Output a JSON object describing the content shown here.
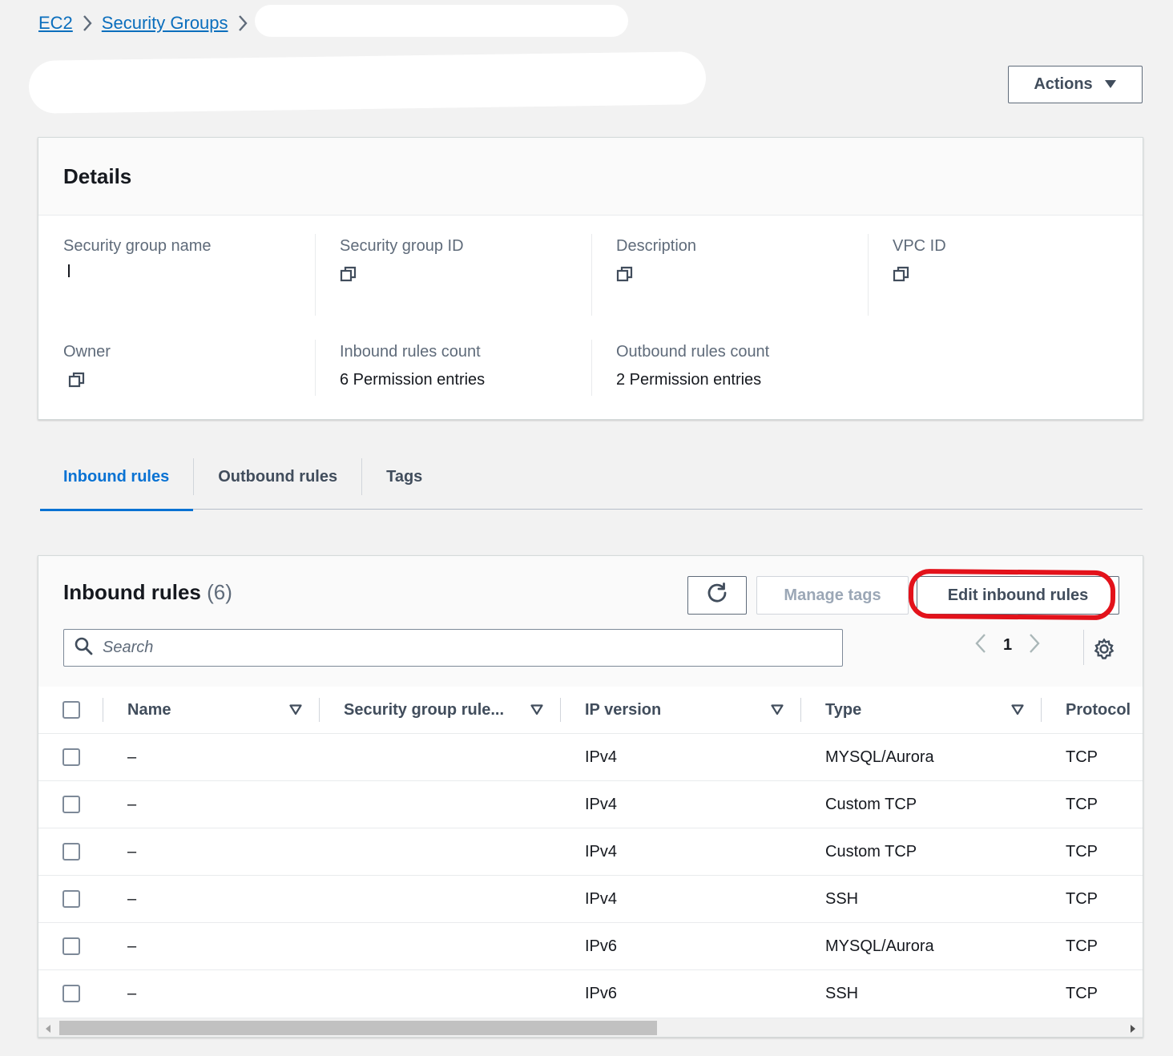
{
  "breadcrumb": {
    "items": [
      "EC2",
      "Security Groups"
    ]
  },
  "actions_label": "Actions",
  "details": {
    "title": "Details",
    "fields": {
      "sg_name_label": "Security group name",
      "sg_id_label": "Security group ID",
      "description_label": "Description",
      "vpc_id_label": "VPC ID",
      "owner_label": "Owner",
      "inbound_count_label": "Inbound rules count",
      "inbound_count_value": "6 Permission entries",
      "outbound_count_label": "Outbound rules count",
      "outbound_count_value": "2 Permission entries"
    }
  },
  "tabs": [
    {
      "label": "Inbound rules",
      "active": true
    },
    {
      "label": "Outbound rules",
      "active": false
    },
    {
      "label": "Tags",
      "active": false
    }
  ],
  "rules": {
    "title": "Inbound rules",
    "count": "(6)",
    "manage_tags_label": "Manage tags",
    "edit_label": "Edit inbound rules",
    "search_placeholder": "Search",
    "page": "1",
    "columns": [
      "Name",
      "Security group rule...",
      "IP version",
      "Type",
      "Protocol"
    ],
    "rows": [
      {
        "name": "–",
        "ip_version": "IPv4",
        "type": "MYSQL/Aurora",
        "protocol": "TCP"
      },
      {
        "name": "–",
        "ip_version": "IPv4",
        "type": "Custom TCP",
        "protocol": "TCP"
      },
      {
        "name": "–",
        "ip_version": "IPv4",
        "type": "Custom TCP",
        "protocol": "TCP"
      },
      {
        "name": "–",
        "ip_version": "IPv4",
        "type": "SSH",
        "protocol": "TCP"
      },
      {
        "name": "–",
        "ip_version": "IPv6",
        "type": "MYSQL/Aurora",
        "protocol": "TCP"
      },
      {
        "name": "–",
        "ip_version": "IPv6",
        "type": "SSH",
        "protocol": "TCP"
      }
    ]
  },
  "colors": {
    "link": "#0a6ebd",
    "tab_active": "#0972d3",
    "highlight": "#e3121b"
  }
}
